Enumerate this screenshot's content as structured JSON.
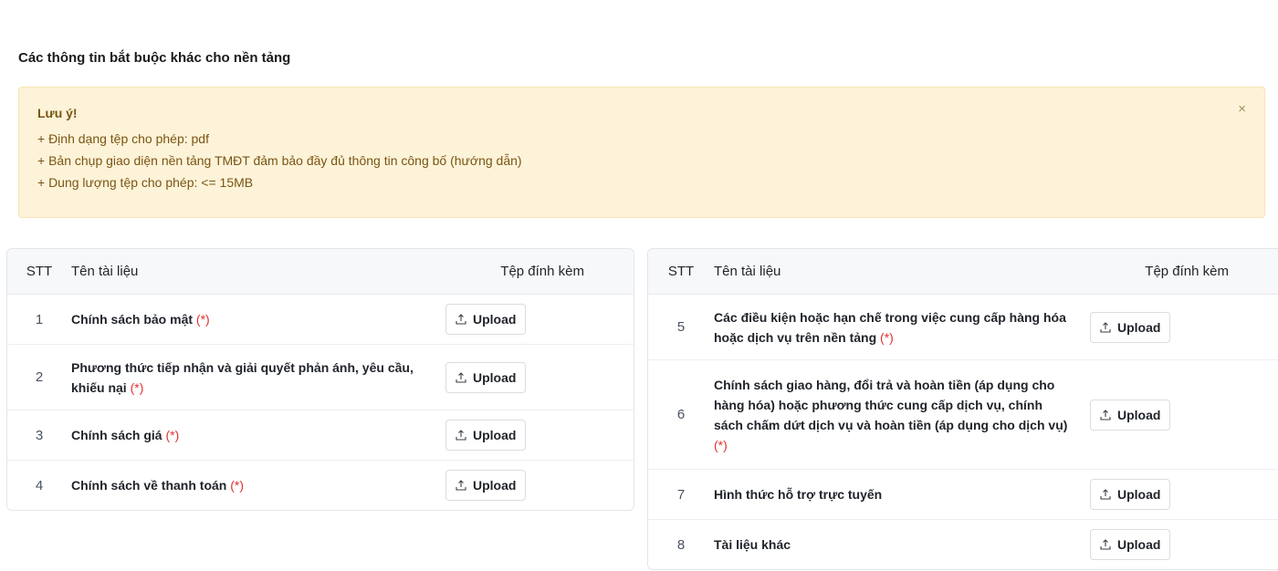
{
  "section": {
    "title": "Các thông tin bắt buộc khác cho nền tảng"
  },
  "alert": {
    "title": "Lưu ý!",
    "lines": [
      "+ Định dạng tệp cho phép: pdf",
      "+ Bản chụp giao diện nền tảng TMĐT đảm bảo đầy đủ thông tin công bố (hướng dẫn)",
      "+ Dung lượng tệp cho phép: <= 15MB"
    ],
    "close_label": "×"
  },
  "table": {
    "headers": {
      "stt": "STT",
      "name": "Tên tài liệu",
      "file": "Tệp đính kèm"
    },
    "upload_label": "Upload",
    "required_mark": "(*)",
    "left_rows": [
      {
        "stt": "1",
        "name": "Chính sách bảo mật",
        "required": true
      },
      {
        "stt": "2",
        "name": "Phương thức tiếp nhận và giải quyết phản ánh, yêu cầu, khiếu nại",
        "required": true
      },
      {
        "stt": "3",
        "name": "Chính sách giá",
        "required": true
      },
      {
        "stt": "4",
        "name": "Chính sách về thanh toán",
        "required": true
      }
    ],
    "right_rows": [
      {
        "stt": "5",
        "name": "Các điều kiện hoặc hạn chế trong việc cung cấp hàng hóa hoặc dịch vụ trên nền tảng",
        "required": true
      },
      {
        "stt": "6",
        "name": "Chính sách giao hàng, đổi trả và hoàn tiền (áp dụng cho hàng hóa) hoặc phương thức cung cấp dịch vụ, chính sách chấm dứt dịch vụ và hoàn tiền (áp dụng cho dịch vụ)",
        "required": true
      },
      {
        "stt": "7",
        "name": "Hình thức hỗ trợ trực tuyến",
        "required": false
      },
      {
        "stt": "8",
        "name": "Tài liệu khác",
        "required": false
      }
    ]
  }
}
